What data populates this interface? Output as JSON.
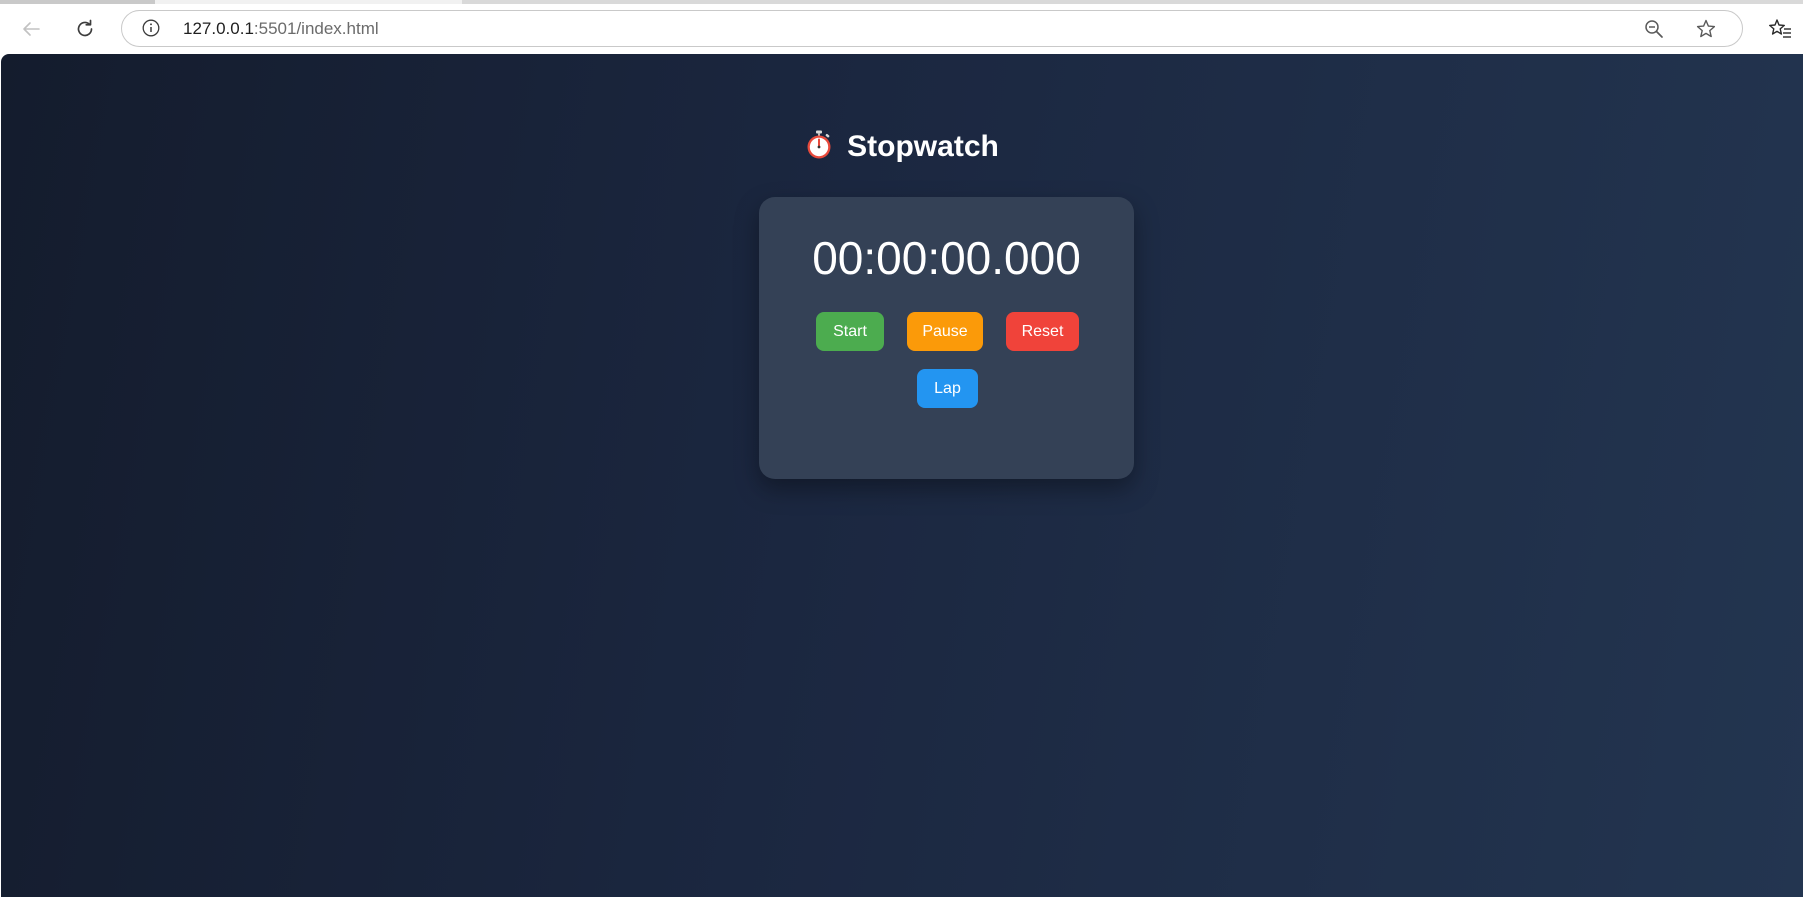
{
  "browser": {
    "url_host": "127.0.0.1",
    "url_rest": ":5501/index.html",
    "icons": {
      "back": "arrow-left",
      "reload": "circular-arrow",
      "info": "info-circle",
      "zoom": "magnifier-minus",
      "favorite": "star-outline",
      "favorites": "star-with-lines"
    }
  },
  "page": {
    "title": "Stopwatch",
    "title_icon": "stopwatch",
    "display_time": "00:00:00.000",
    "buttons": {
      "start": "Start",
      "pause": "Pause",
      "reset": "Reset",
      "lap": "Lap"
    },
    "laps": []
  },
  "colors": {
    "background_from": "#141c2d",
    "background_to": "#233550",
    "card": "#344156",
    "start": "#4cac4f",
    "pause": "#fb9a09",
    "reset": "#f0433a",
    "lap": "#2395f1"
  }
}
